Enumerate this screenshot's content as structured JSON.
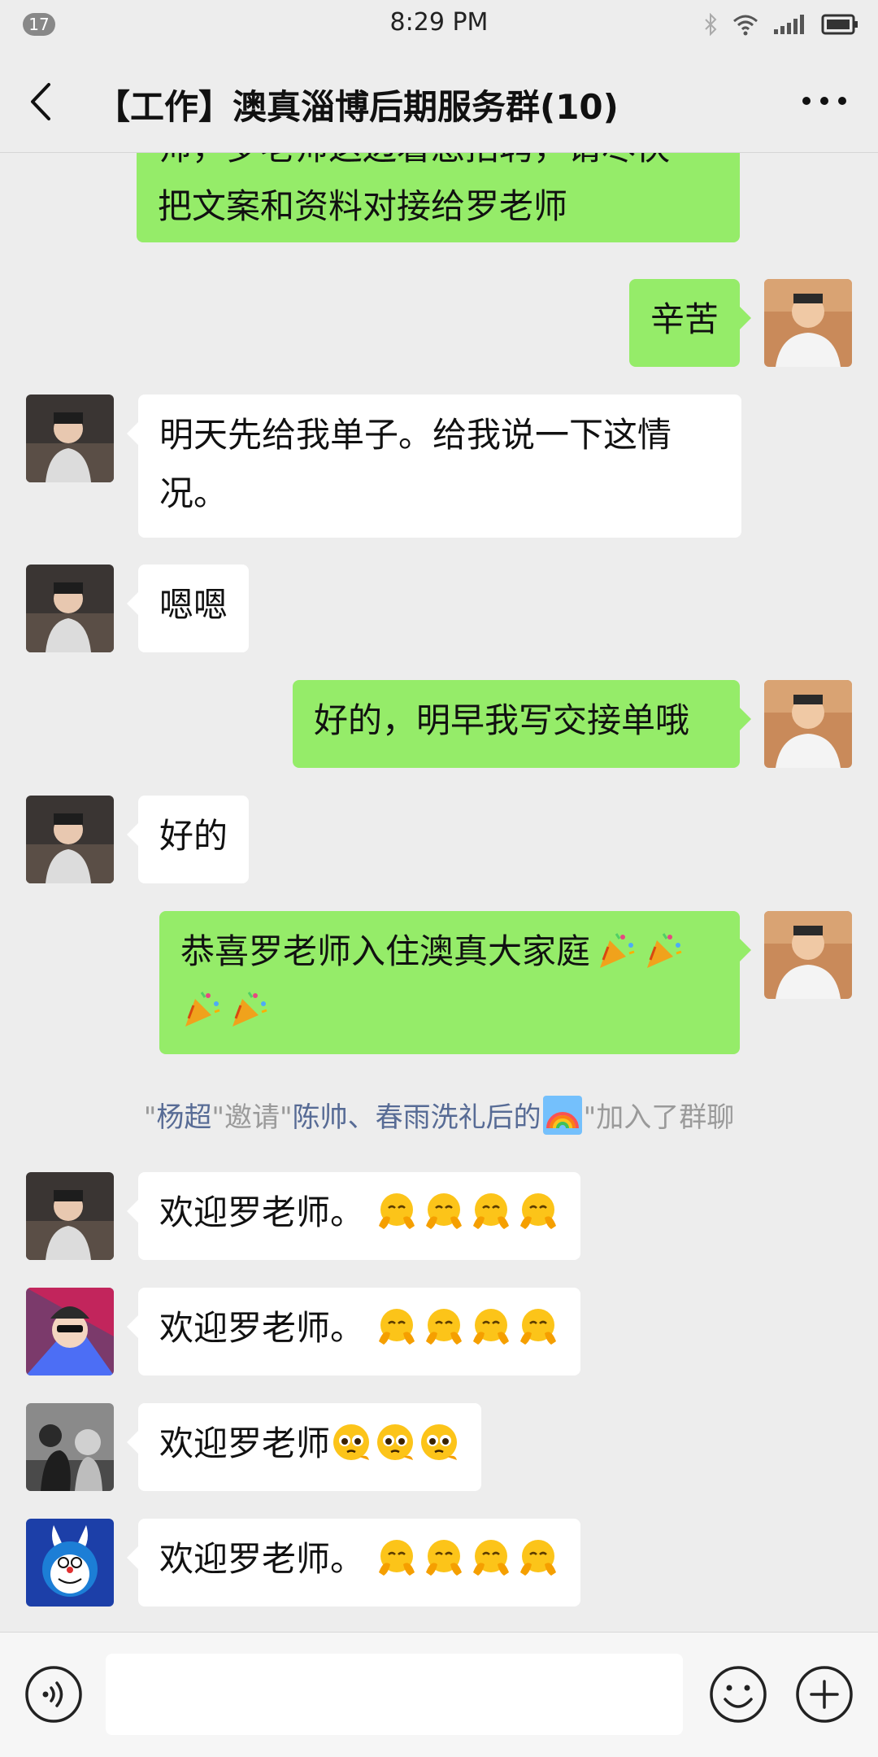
{
  "status_bar": {
    "notification_count": "17",
    "time": "8:29 PM",
    "icons": [
      "bluetooth-icon",
      "wifi-icon",
      "signal-icon",
      "battery-icon"
    ]
  },
  "header": {
    "title": "【工作】澳真淄博后期服务群(10)",
    "back_icon": "chevron-left-icon",
    "more_icon": "more-dots-icon"
  },
  "messages": [
    {
      "id": "m0",
      "side": "right",
      "text": "师，罗老师这边着急招聘，请尽快把文案和资料对接给罗老师",
      "display_line1": "师，罗老师这边着急招聘，请尽快",
      "display_line2": "把文案和资料对接给罗老师"
    },
    {
      "id": "m1",
      "side": "right",
      "text": "辛苦"
    },
    {
      "id": "m2",
      "side": "left",
      "text_line1": "明天先给我单子。给我说一下这情",
      "text_line2": "况。"
    },
    {
      "id": "m3",
      "side": "left",
      "text": "嗯嗯"
    },
    {
      "id": "m4",
      "side": "right",
      "text": "好的，明早我写交接单哦"
    },
    {
      "id": "m5",
      "side": "left",
      "text": "好的"
    },
    {
      "id": "m6",
      "side": "right",
      "text": "恭喜罗老师入住澳真大家庭",
      "emoji": "party-popper-icon",
      "emoji_count": 4
    },
    {
      "id": "m7",
      "side": "left",
      "text": "欢迎罗老师。",
      "emoji": "clapping-face-icon",
      "emoji_count": 4
    },
    {
      "id": "m8",
      "side": "left",
      "text": "欢迎罗老师。",
      "emoji": "clapping-face-icon",
      "emoji_count": 4
    },
    {
      "id": "m9",
      "side": "left",
      "text": "欢迎罗老师",
      "emoji": "pleading-face-icon",
      "emoji_count": 3
    },
    {
      "id": "m10",
      "side": "left",
      "text": "欢迎罗老师。",
      "emoji": "clapping-face-icon",
      "emoji_count": 4
    }
  ],
  "system_message": {
    "q1": "\"",
    "inviter": "杨超",
    "mid": "\"邀请\"",
    "invitees": "陈帅、春雨洗礼后的",
    "emoji": "rainbow-icon",
    "tail": "\"加入了群聊"
  },
  "input_bar": {
    "placeholder": "",
    "voice_icon": "voice-icon",
    "emoji_icon": "smiley-icon",
    "plus_icon": "plus-icon"
  },
  "colors": {
    "chat_bg": "#ededed",
    "bubble_self": "#95ec69",
    "bubble_other": "#ffffff",
    "link_blue": "#576b95"
  }
}
